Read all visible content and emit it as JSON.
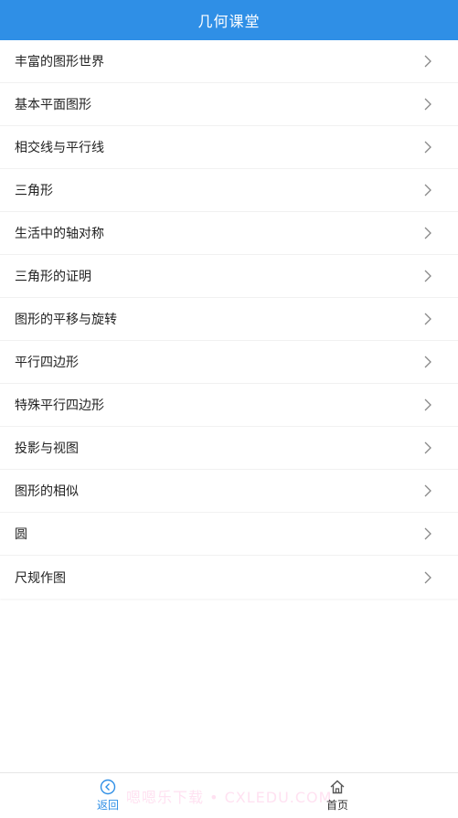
{
  "header": {
    "title": "几何课堂",
    "background_color": "#2f8fe6"
  },
  "list": {
    "items": [
      {
        "label": "丰富的图形世界"
      },
      {
        "label": "基本平面图形"
      },
      {
        "label": "相交线与平行线"
      },
      {
        "label": "三角形"
      },
      {
        "label": "生活中的轴对称"
      },
      {
        "label": "三角形的证明"
      },
      {
        "label": "图形的平移与旋转"
      },
      {
        "label": "平行四边形"
      },
      {
        "label": "特殊平行四边形"
      },
      {
        "label": "投影与视图"
      },
      {
        "label": "图形的相似"
      },
      {
        "label": "圆"
      },
      {
        "label": "尺规作图"
      }
    ],
    "item_icon": "chevron-right-icon"
  },
  "bottom_nav": {
    "back": {
      "label": "返回",
      "icon": "back-circle-icon",
      "color": "#2f8fe6"
    },
    "home": {
      "label": "首页",
      "icon": "home-icon"
    }
  },
  "watermark": "嗯嗯乐下载 • CXLEDU.COM"
}
